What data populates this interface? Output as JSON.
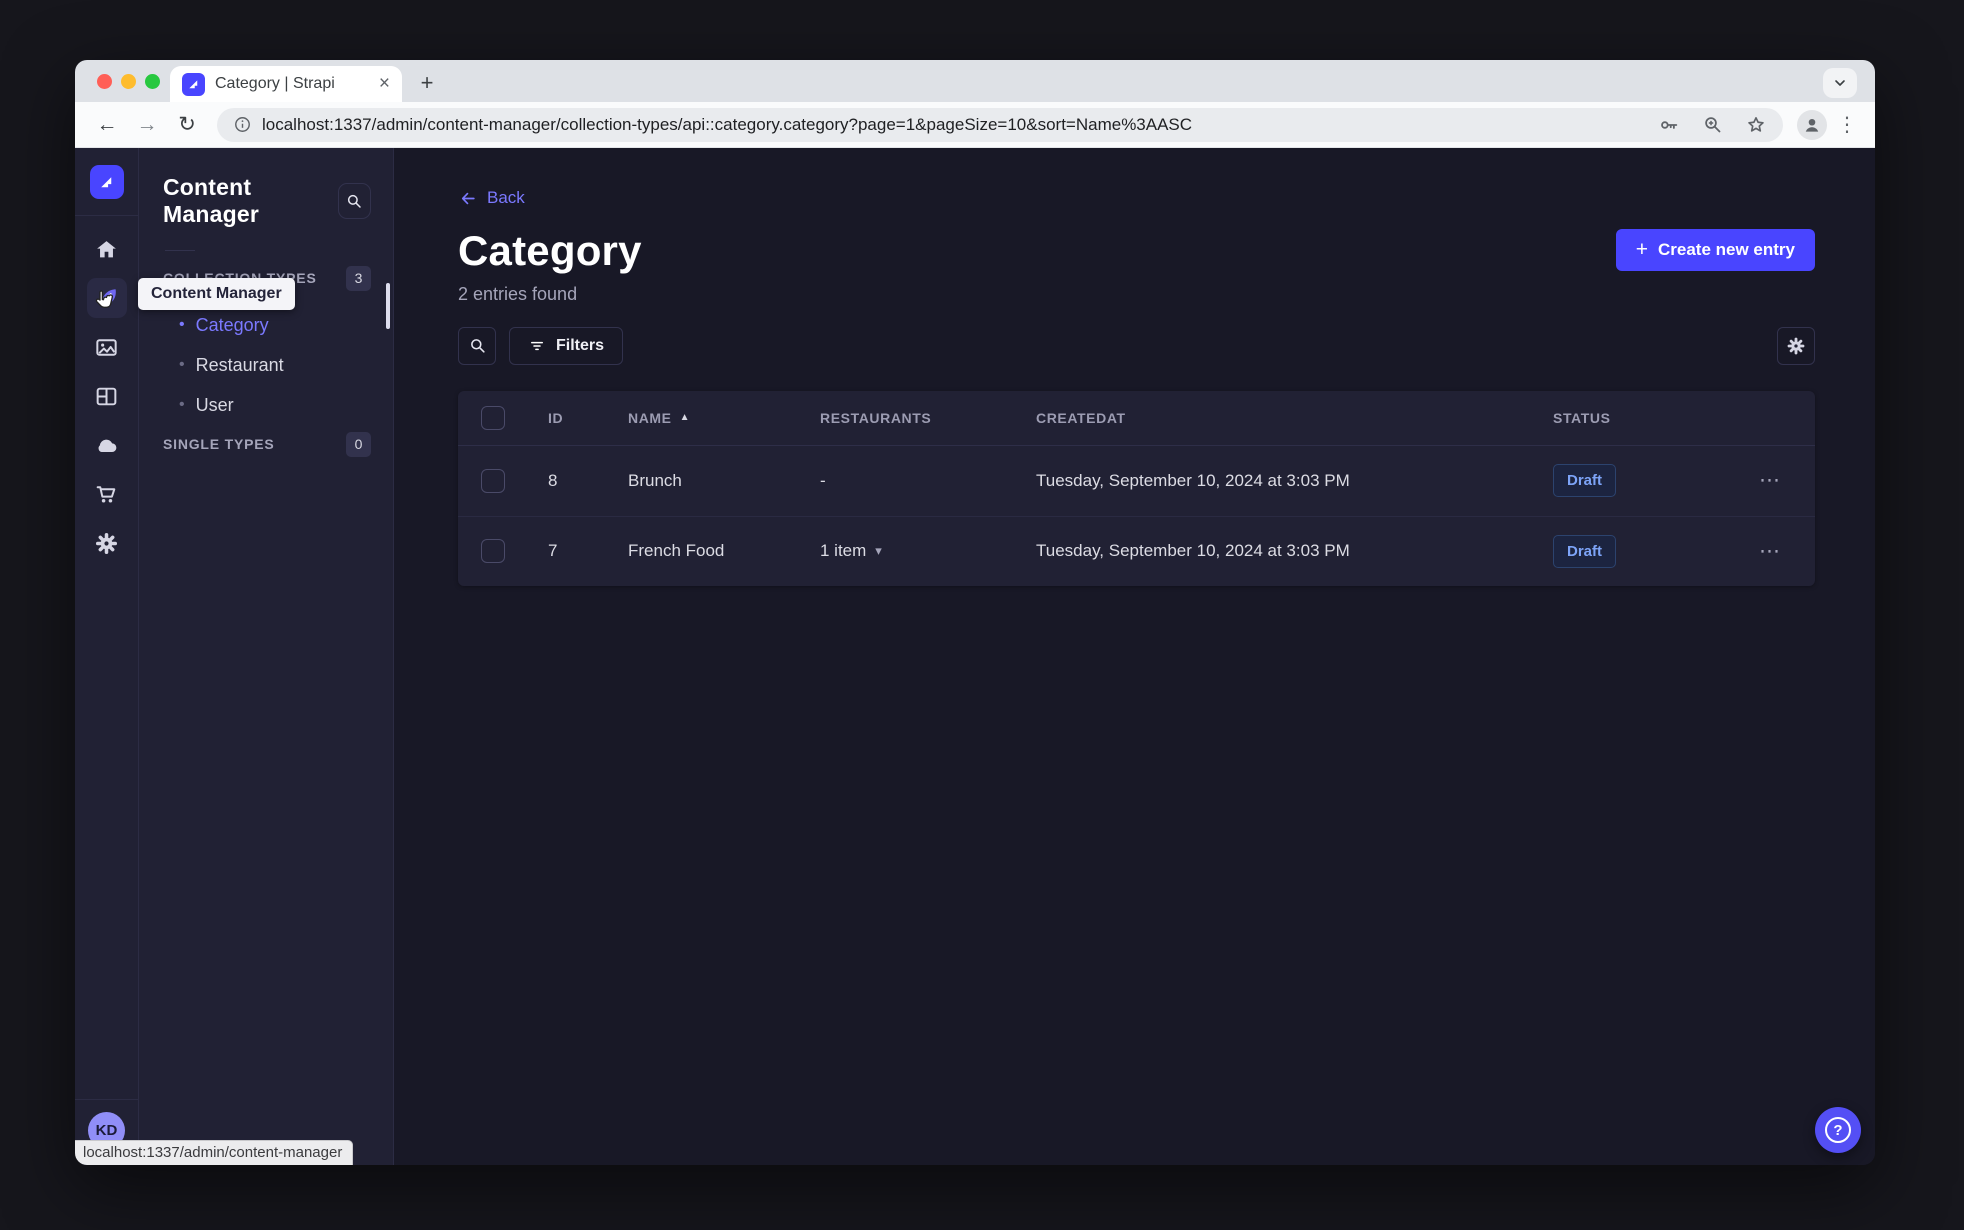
{
  "colors": {
    "primary": "#4945ff",
    "link": "#7b79ff",
    "app_background": "#181826",
    "surface": "#212134",
    "border": "#32324d",
    "muted_text": "#a5a5ba",
    "draft_text": "#7da4f8",
    "avatar_bg": "#908ef7"
  },
  "browser": {
    "tab_title": "Category | Strapi",
    "url": "localhost:1337/admin/content-manager/collection-types/api::category.category?page=1&pageSize=10&sort=Name%3AASC",
    "status_bar": "localhost:1337/admin/content-manager"
  },
  "nav": {
    "tooltip": "Content Manager",
    "user_initials": "KD"
  },
  "panel": {
    "title": "Content Manager",
    "collection_types": {
      "label": "COLLECTION TYPES",
      "count": "3",
      "items": [
        {
          "label": "Category",
          "active": true
        },
        {
          "label": "Restaurant",
          "active": false
        },
        {
          "label": "User",
          "active": false
        }
      ]
    },
    "single_types": {
      "label": "SINGLE TYPES",
      "count": "0"
    }
  },
  "main": {
    "back": "Back",
    "title": "Category",
    "subtitle": "2 entries found",
    "create_button": "Create new entry",
    "filters_button": "Filters"
  },
  "table": {
    "headers": {
      "id": "ID",
      "name": "NAME",
      "restaurants": "RESTAURANTS",
      "createdat": "CREATEDAT",
      "status": "STATUS"
    },
    "rows": [
      {
        "id": "8",
        "name": "Brunch",
        "restaurants": "-",
        "createdAt": "Tuesday, September 10, 2024 at 3:03 PM",
        "status": "Draft"
      },
      {
        "id": "7",
        "name": "French Food",
        "restaurants": "1 item",
        "createdAt": "Tuesday, September 10, 2024 at 3:03 PM",
        "status": "Draft"
      }
    ]
  },
  "icons": {
    "plus": "+",
    "close": "×",
    "kebab": "⋮",
    "ellipsis": "⋯",
    "caret_down": "▾",
    "sort_asc": "▲",
    "bullet": "•",
    "question": "?",
    "reload": "↻",
    "back_arrow": "←",
    "forward_arrow": "→"
  }
}
